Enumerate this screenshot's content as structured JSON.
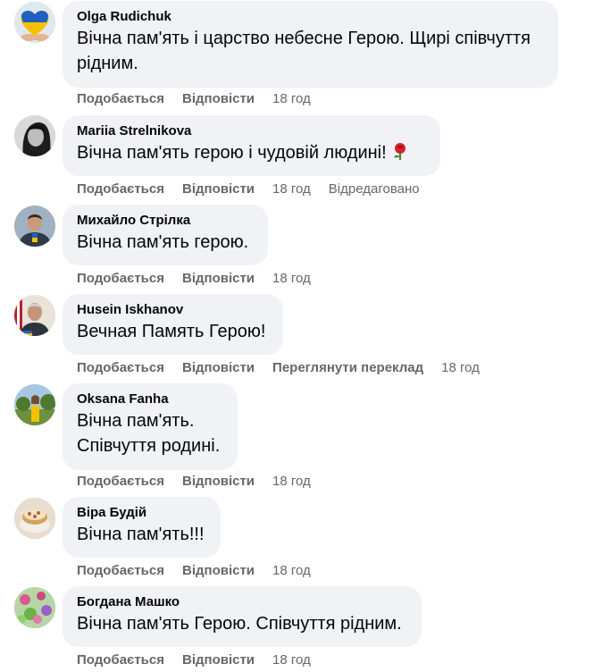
{
  "actions": {
    "like": "Подобається",
    "reply": "Відповісти",
    "see_translation": "Переглянути переклад"
  },
  "comments": [
    {
      "author": "Olga Rudichuk",
      "text": "Вічна пам'ять і царство небесне Герою. Щирі співчуття\nрідним.",
      "time": "18 год",
      "avatar_icon": "ukraine-heart-avatar"
    },
    {
      "author": "Mariia Strelnikova",
      "text": "Вічна пам'ять герою і чудовій людині!",
      "emoji": "rose-emoji",
      "time": "18 год",
      "edited": "Відредаговано",
      "avatar_icon": "bw-portrait-avatar"
    },
    {
      "author": "Михайло Стрілка",
      "text": "Вічна пам'ять герою.",
      "time": "18 год",
      "avatar_icon": "man-portrait-avatar"
    },
    {
      "author": "Husein Iskhanov",
      "text": "Вечная Память Герою!",
      "time": "18 год",
      "avatar_icon": "man-with-flag-avatar"
    },
    {
      "author": "Oksana Fanha",
      "text": "Вічна пам'ять.\nСпівчуття родині.",
      "time": "18 год",
      "avatar_icon": "woman-outdoor-avatar"
    },
    {
      "author": "Віра Будій",
      "text": "Вічна пам'ять!!!",
      "time": "18 год",
      "avatar_icon": "cake-avatar"
    },
    {
      "author": "Богдана Машко",
      "text": "Вічна пам'ять Герою. Співчуття рідним.",
      "time": "18 год",
      "avatar_icon": "flowers-avatar"
    }
  ]
}
